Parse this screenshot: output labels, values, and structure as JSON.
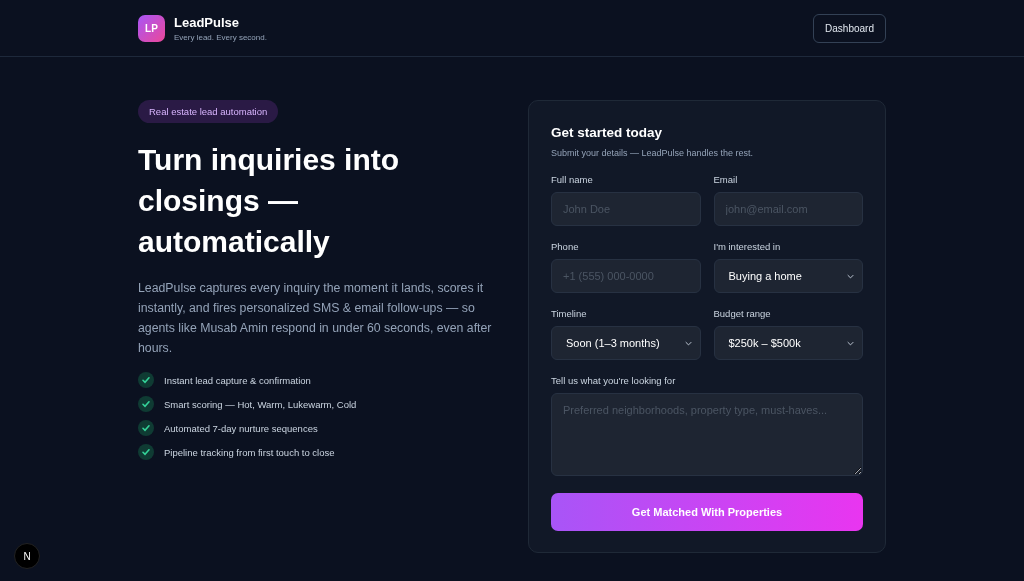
{
  "header": {
    "logo": "LP",
    "brand": "LeadPulse",
    "tagline": "Every lead. Every second.",
    "button": "Dashboard"
  },
  "hero": {
    "badge": "Real estate lead automation",
    "title": "Turn inquiries into closings — automatically",
    "description": "LeadPulse captures every inquiry the moment it lands, scores it instantly, and fires personalized SMS & email follow-ups — so agents like Musab Amin respond in under 60 seconds, even after hours.",
    "features": [
      "Instant lead capture & confirmation",
      "Smart scoring — Hot, Warm, Lukewarm, Cold",
      "Automated 7-day nurture sequences",
      "Pipeline tracking from first touch to close"
    ]
  },
  "form": {
    "title": "Get started today",
    "subtitle": "Submit your details — LeadPulse handles the rest.",
    "fields": [
      {
        "kind": "input",
        "label": "Full name",
        "placeholder": "John Doe"
      },
      {
        "kind": "input",
        "label": "Email",
        "placeholder": "john@email.com"
      },
      {
        "kind": "input",
        "label": "Phone",
        "placeholder": "+1 (555) 000-0000"
      },
      {
        "kind": "select",
        "label": "I'm interested in",
        "value": "Buying a home"
      },
      {
        "kind": "select",
        "label": "Timeline",
        "value": "Soon (1–3 months)"
      },
      {
        "kind": "select",
        "label": "Budget range",
        "value": "$250k – $500k"
      },
      {
        "kind": "textarea",
        "label": "Tell us what you're looking for",
        "placeholder": "Preferred neighborhoods, property type, must-haves..."
      }
    ],
    "submit": "Get Matched With Properties"
  },
  "dev_badge": "N"
}
